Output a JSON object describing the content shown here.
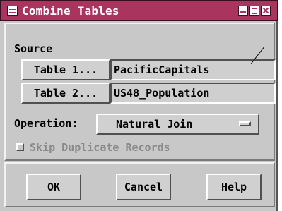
{
  "window": {
    "title": "Combine Tables"
  },
  "source": {
    "label": "Source",
    "table1_button": "Table 1...",
    "table1_value": "PacificCapitals",
    "table2_button": "Table 2...",
    "table2_value": "US48_Population"
  },
  "operation": {
    "label": "Operation:",
    "selected": "Natural Join"
  },
  "skip_duplicates": {
    "label": "Skip Duplicate Records",
    "checked": false,
    "enabled": false
  },
  "actions": {
    "ok": "OK",
    "cancel": "Cancel",
    "help": "Help"
  },
  "colors": {
    "titlebar": "#a9345e",
    "background": "#c8c8c8",
    "disabled_text": "#8a8a8a"
  },
  "icons": [
    "system-menu-icon",
    "minimize-icon",
    "maximize-icon",
    "close-icon",
    "option-menu-indicator-icon"
  ]
}
